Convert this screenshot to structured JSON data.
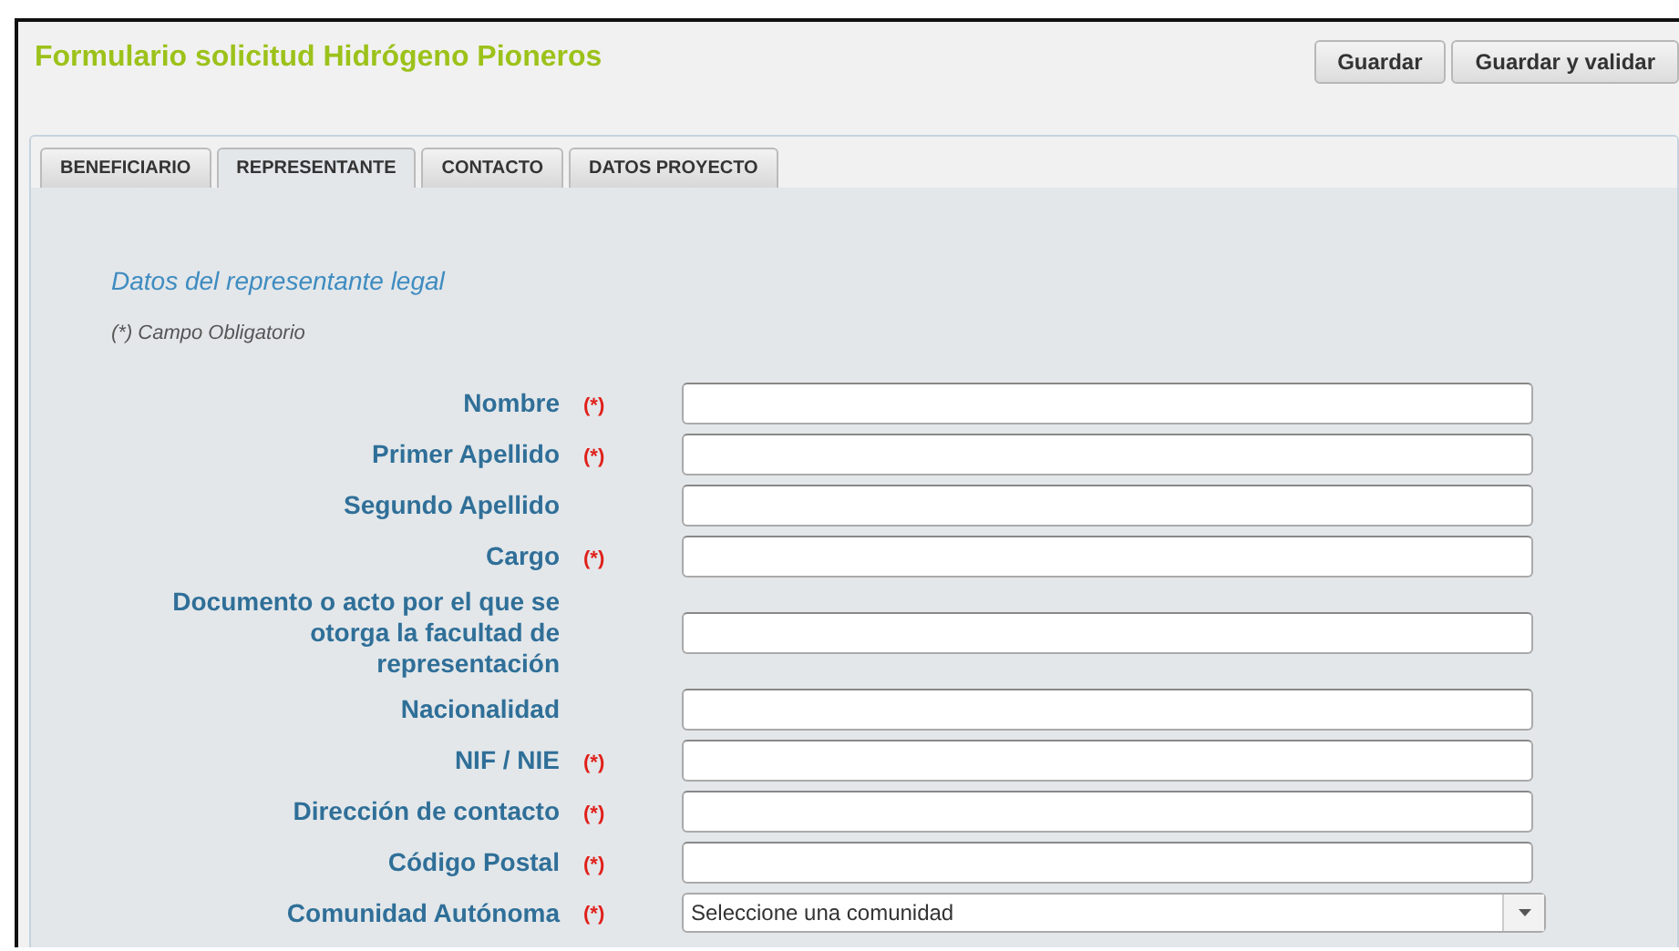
{
  "header": {
    "title": "Formulario solicitud Hidrógeno Pioneros",
    "buttons": [
      "Guardar",
      "Guardar y validar"
    ]
  },
  "tabs": [
    {
      "label": "BENEFICIARIO",
      "selected": false
    },
    {
      "label": "REPRESENTANTE",
      "selected": true
    },
    {
      "label": "CONTACTO",
      "selected": false
    },
    {
      "label": "DATOS PROYECTO",
      "selected": false
    }
  ],
  "section": {
    "title": "Datos del representante legal",
    "note": "(*) Campo Obligatorio"
  },
  "fields": [
    {
      "label": "Nombre",
      "required_mark": "(*)",
      "kind": "text"
    },
    {
      "label": "Primer Apellido",
      "required_mark": "(*)",
      "kind": "text"
    },
    {
      "label": "Segundo Apellido",
      "kind": "text"
    },
    {
      "label": "Cargo",
      "required_mark": "(*)",
      "kind": "text"
    },
    {
      "label": "Documento o acto por el que se otorga la facultad de representación",
      "kind": "text"
    },
    {
      "label": "Nacionalidad",
      "kind": "text"
    },
    {
      "label": "NIF / NIE",
      "required_mark": "(*)",
      "kind": "text"
    },
    {
      "label": "Dirección de contacto",
      "required_mark": "(*)",
      "kind": "text"
    },
    {
      "label": "Código Postal",
      "required_mark": "(*)",
      "kind": "text"
    },
    {
      "label": "Comunidad Autónoma",
      "required_mark": "(*)",
      "kind": "select",
      "value": "Seleccione una comunidad"
    }
  ]
}
